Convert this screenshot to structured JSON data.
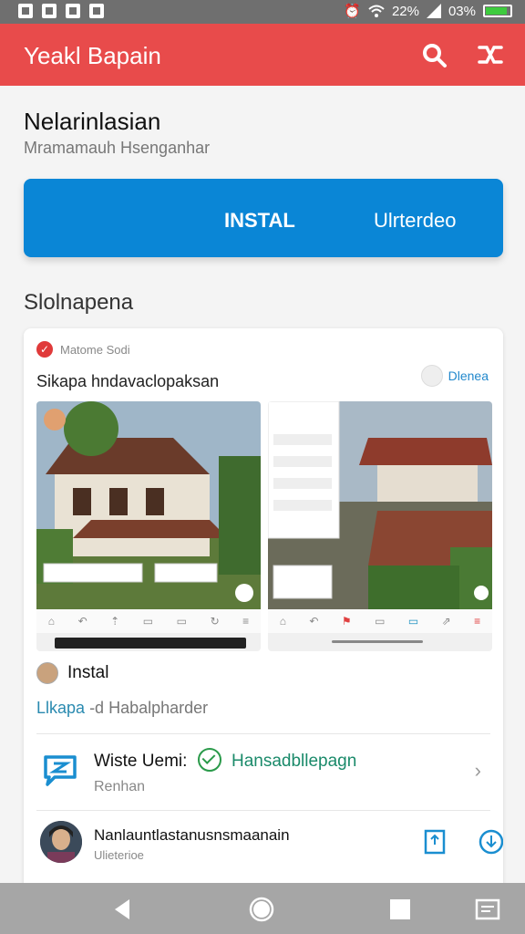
{
  "status_bar": {
    "time": "22%",
    "battery": "03%",
    "battery_level": 0.9,
    "battery_color": "#3ecb3e"
  },
  "app_bar": {
    "title": "Yeakl Bapain",
    "color": "#e84b4b",
    "search_icon": "search-icon",
    "share_icon": "shuffle-icon"
  },
  "header": {
    "title": "Nelarinlasian",
    "subtitle": "Mramamauh Hsenganhar"
  },
  "install_bar": {
    "label": "INSTAL",
    "label2": "Ulrterdeo",
    "color": "#0a86d6"
  },
  "section": {
    "title": "Slolnapena"
  },
  "card": {
    "badge": "Matome Sodi",
    "title": "Sikapa hndavaclopaksan",
    "action_label": "Dlenea",
    "install_label": "Instal",
    "tagline_prefix": "Llkapa",
    "tagline_rest": "-d Habalpharder",
    "row1": {
      "title": "Wiste Uemi:",
      "highlight": "Hansadbllepagn",
      "subtitle": "Renhan"
    },
    "row2": {
      "title": "Nanlauntlastanusnsmaanain",
      "subtitle": "Ulieterioe"
    }
  }
}
